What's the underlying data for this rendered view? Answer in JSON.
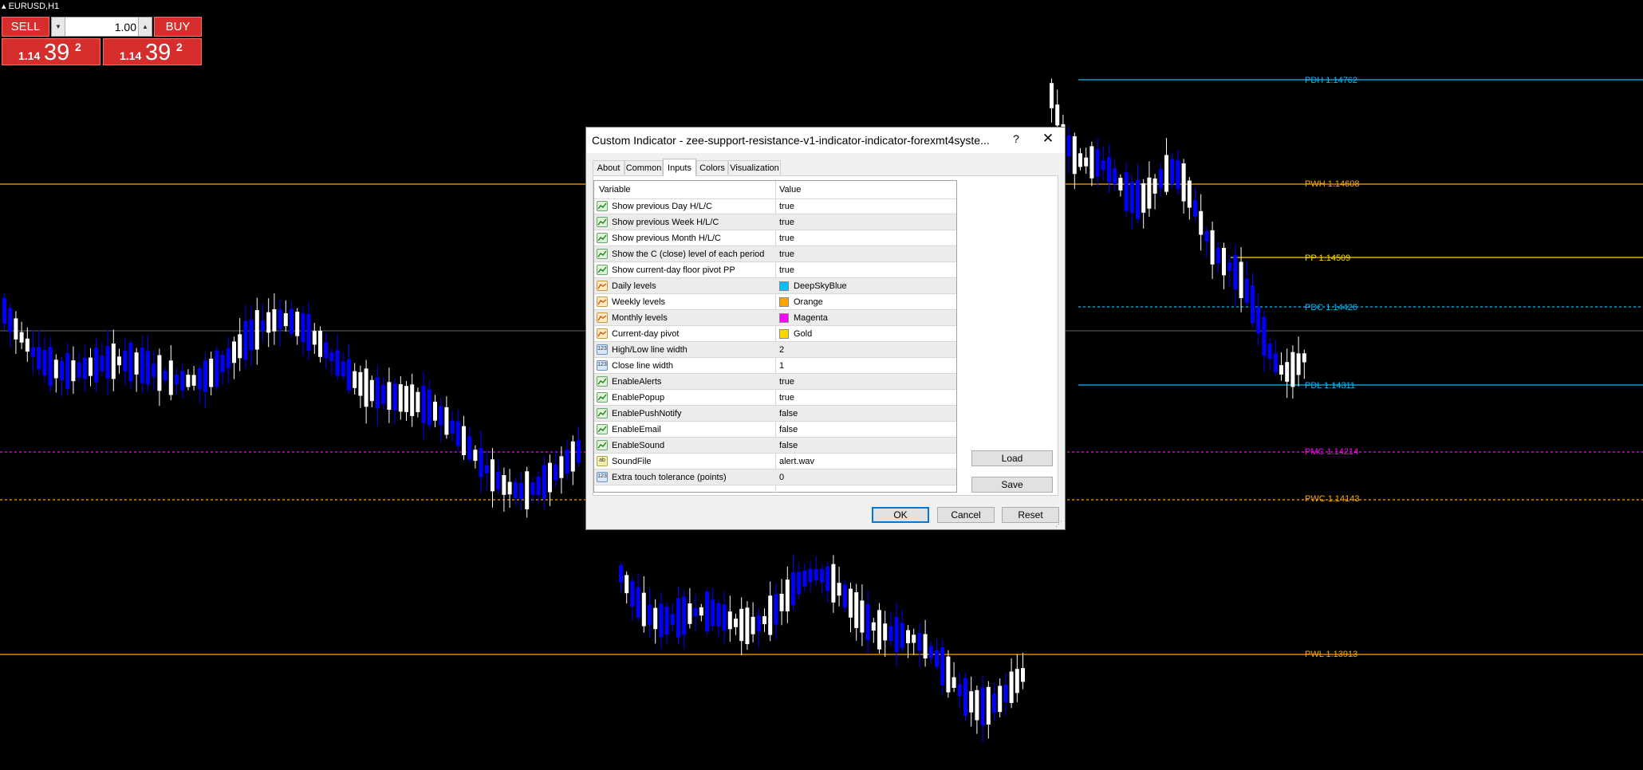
{
  "chart": {
    "symbol": "EURUSD,H1",
    "colors": {
      "background": "#000000",
      "bull_candle": "#ffffff",
      "bear_candle": "#0000ff",
      "daily": "#00bfff",
      "weekly": "#ffa500",
      "monthly": "#ff00ff",
      "pivot": "#ffd700",
      "grid_line": "#ffffff"
    },
    "levels": [
      {
        "label": "PDH 1.14762",
        "color": "#00bfff"
      },
      {
        "label": "PWH 1.14608",
        "color": "#ffa500"
      },
      {
        "label": "PP 1.14509",
        "color": "#ffd700"
      },
      {
        "label": "PDC 1.14426",
        "color": "#00bfff"
      },
      {
        "label": "PDL 1.14311",
        "color": "#00bfff"
      },
      {
        "label": "PMC 1.14214",
        "color": "#ff00ff"
      },
      {
        "label": "PWC 1.14143",
        "color": "#ffa500"
      },
      {
        "label": "PWL 1.13913",
        "color": "#ffa500"
      }
    ]
  },
  "trade_panel": {
    "sell_label": "SELL",
    "buy_label": "BUY",
    "lot_value": "1.00",
    "sell_price": {
      "small": "1.14",
      "big": "39",
      "sup": "2"
    },
    "buy_price": {
      "small": "1.14",
      "big": "39",
      "sup": "2"
    }
  },
  "dialog": {
    "title": "Custom Indicator - zee-support-resistance-v1-indicator-indicator-forexmt4syste...",
    "help_label": "?",
    "close_label": "✕",
    "tabs": [
      "About",
      "Common",
      "Inputs",
      "Colors",
      "Visualization"
    ],
    "active_tab": "Inputs",
    "grid_headers": {
      "variable": "Variable",
      "value": "Value"
    },
    "rows": [
      {
        "icon": "bool",
        "name": "Show previous Day H/L/C",
        "value": "true"
      },
      {
        "icon": "bool",
        "name": "Show previous Week H/L/C",
        "value": "true"
      },
      {
        "icon": "bool",
        "name": "Show previous Month H/L/C",
        "value": "true"
      },
      {
        "icon": "bool",
        "name": "Show the C (close) level of each period",
        "value": "true"
      },
      {
        "icon": "bool",
        "name": "Show current-day floor pivot PP",
        "value": "true"
      },
      {
        "icon": "color",
        "name": "Daily levels",
        "value": "DeepSkyBlue",
        "swatch": "#00bfff"
      },
      {
        "icon": "color",
        "name": "Weekly levels",
        "value": "Orange",
        "swatch": "#ffa500"
      },
      {
        "icon": "color",
        "name": "Monthly levels",
        "value": "Magenta",
        "swatch": "#ff00ff"
      },
      {
        "icon": "color",
        "name": "Current-day pivot",
        "value": "Gold",
        "swatch": "#ffd700"
      },
      {
        "icon": "int",
        "name": "High/Low line width",
        "value": "2"
      },
      {
        "icon": "int",
        "name": "Close line width",
        "value": "1"
      },
      {
        "icon": "bool",
        "name": "EnableAlerts",
        "value": "true"
      },
      {
        "icon": "bool",
        "name": "EnablePopup",
        "value": "true"
      },
      {
        "icon": "bool",
        "name": "EnablePushNotify",
        "value": "false"
      },
      {
        "icon": "bool",
        "name": "EnableEmail",
        "value": "false"
      },
      {
        "icon": "bool",
        "name": "EnableSound",
        "value": "false"
      },
      {
        "icon": "str",
        "name": "SoundFile",
        "value": "alert.wav"
      },
      {
        "icon": "int",
        "name": "Extra touch tolerance (points)",
        "value": "0"
      }
    ],
    "icon_text": {
      "int": "123",
      "str": "ab"
    },
    "buttons": {
      "load": "Load",
      "save": "Save",
      "ok": "OK",
      "cancel": "Cancel",
      "reset": "Reset"
    }
  }
}
